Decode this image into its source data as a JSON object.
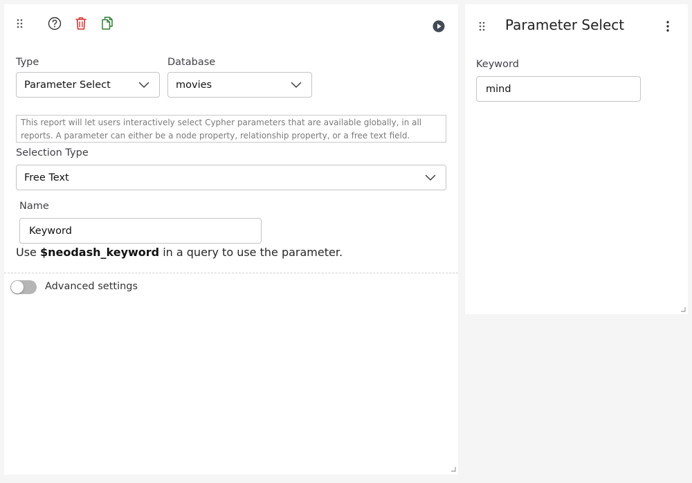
{
  "editor": {
    "toolbar": {
      "icons": [
        "drag-handle-icon",
        "help-icon",
        "trash-icon",
        "copy-icon",
        "play-icon"
      ]
    },
    "type_field": {
      "label": "Type",
      "value": "Parameter Select"
    },
    "database_field": {
      "label": "Database",
      "value": "movies"
    },
    "description": "This report will let users interactively select Cypher parameters that are available globally, in all reports. A parameter can either be a node property, relationship property, or a free text field.",
    "selection_type": {
      "label": "Selection Type",
      "value": "Free Text"
    },
    "name_field": {
      "label": "Name",
      "value": "Keyword"
    },
    "hint": {
      "prefix": "Use ",
      "param": "$neodash_keyword",
      "suffix": " in a query to use the parameter."
    },
    "advanced": {
      "label": "Advanced settings",
      "enabled": false
    }
  },
  "preview": {
    "title": "Parameter Select",
    "field": {
      "label": "Keyword",
      "value": "mind"
    }
  },
  "colors": {
    "trash": "#d32f2f",
    "copy": "#2e7d32",
    "play": "#424a55",
    "help": "#333333"
  }
}
